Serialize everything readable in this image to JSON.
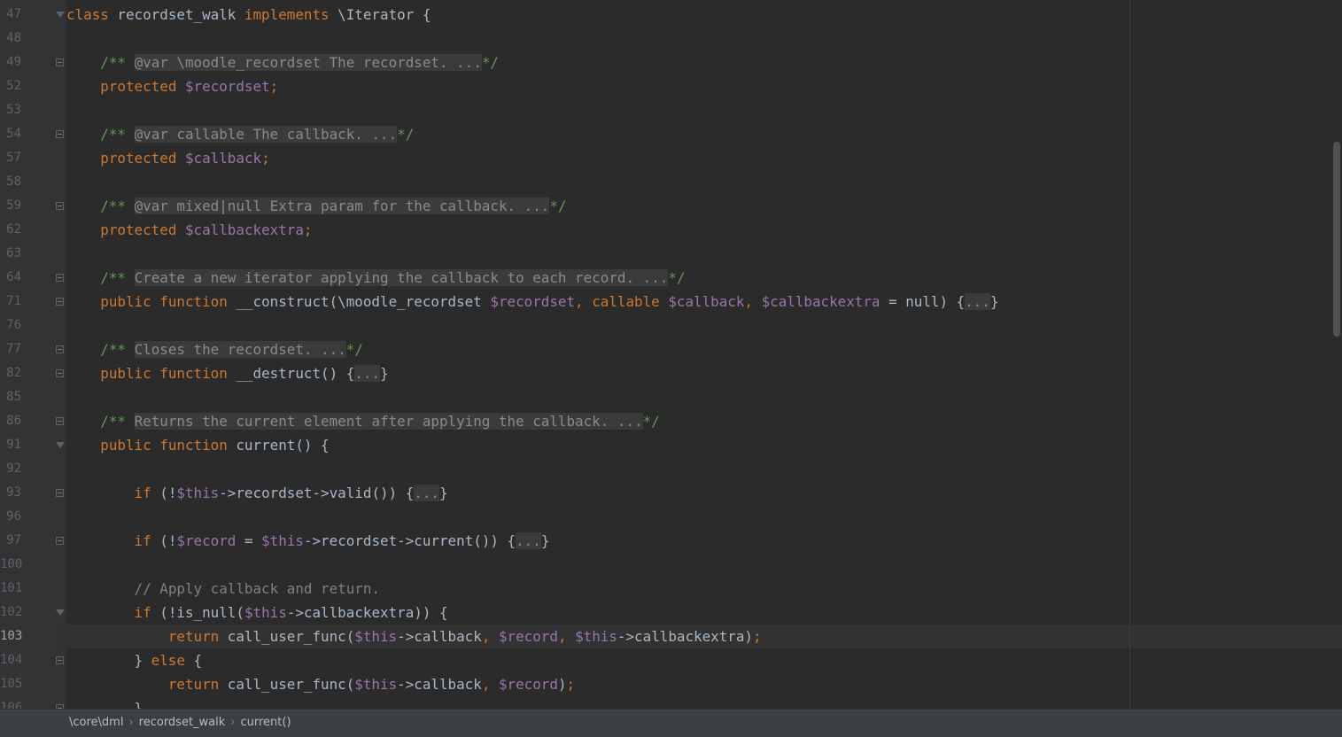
{
  "lines": [
    {
      "n": "47",
      "fold": "open",
      "t": [
        [
          "kw",
          "class"
        ],
        [
          "p",
          " recordset_walk "
        ],
        [
          "kw",
          "implements"
        ],
        [
          "p",
          " \\Iterator {"
        ]
      ]
    },
    {
      "n": "48",
      "t": []
    },
    {
      "n": "49",
      "fold": "box",
      "t": [
        [
          "p",
          "    "
        ],
        [
          "doc",
          "/** "
        ],
        [
          "foldtext",
          "@var \\moodle_recordset The recordset. ..."
        ],
        [
          "doc",
          "*/"
        ]
      ]
    },
    {
      "n": "52",
      "t": [
        [
          "p",
          "    "
        ],
        [
          "kw",
          "protected"
        ],
        [
          "p",
          " "
        ],
        [
          "var",
          "$recordset"
        ],
        [
          "kw",
          ";"
        ]
      ]
    },
    {
      "n": "53",
      "t": []
    },
    {
      "n": "54",
      "fold": "box",
      "t": [
        [
          "p",
          "    "
        ],
        [
          "doc",
          "/** "
        ],
        [
          "foldtext",
          "@var callable The callback. ..."
        ],
        [
          "doc",
          "*/"
        ]
      ]
    },
    {
      "n": "57",
      "t": [
        [
          "p",
          "    "
        ],
        [
          "kw",
          "protected"
        ],
        [
          "p",
          " "
        ],
        [
          "var",
          "$callback"
        ],
        [
          "kw",
          ";"
        ]
      ]
    },
    {
      "n": "58",
      "t": []
    },
    {
      "n": "59",
      "fold": "box",
      "t": [
        [
          "p",
          "    "
        ],
        [
          "doc",
          "/** "
        ],
        [
          "foldtext",
          "@var mixed|null Extra param for the callback. ..."
        ],
        [
          "doc",
          "*/"
        ]
      ]
    },
    {
      "n": "62",
      "t": [
        [
          "p",
          "    "
        ],
        [
          "kw",
          "protected"
        ],
        [
          "p",
          " "
        ],
        [
          "var",
          "$callbackextra"
        ],
        [
          "kw",
          ";"
        ]
      ]
    },
    {
      "n": "63",
      "t": []
    },
    {
      "n": "64",
      "fold": "box",
      "t": [
        [
          "p",
          "    "
        ],
        [
          "doc",
          "/** "
        ],
        [
          "foldtext",
          "Create a new iterator applying the callback to each record. ..."
        ],
        [
          "doc",
          "*/"
        ]
      ]
    },
    {
      "n": "71",
      "fold": "box",
      "t": [
        [
          "p",
          "    "
        ],
        [
          "kw",
          "public function"
        ],
        [
          "p",
          " __construct(\\moodle_recordset "
        ],
        [
          "var",
          "$recordset"
        ],
        [
          "kw",
          ", "
        ],
        [
          "kw",
          "callable"
        ],
        [
          "p",
          " "
        ],
        [
          "var",
          "$callback"
        ],
        [
          "kw",
          ", "
        ],
        [
          "var",
          "$callbackextra"
        ],
        [
          "p",
          " = null) {"
        ],
        [
          "foldbox",
          "..."
        ],
        [
          "p",
          "}"
        ]
      ]
    },
    {
      "n": "76",
      "t": []
    },
    {
      "n": "77",
      "fold": "box",
      "t": [
        [
          "p",
          "    "
        ],
        [
          "doc",
          "/** "
        ],
        [
          "foldtext",
          "Closes the recordset. ..."
        ],
        [
          "doc",
          "*/"
        ]
      ]
    },
    {
      "n": "82",
      "fold": "box",
      "t": [
        [
          "p",
          "    "
        ],
        [
          "kw",
          "public function"
        ],
        [
          "p",
          " __destruct() {"
        ],
        [
          "foldbox",
          "..."
        ],
        [
          "p",
          "}"
        ]
      ]
    },
    {
      "n": "85",
      "t": []
    },
    {
      "n": "86",
      "fold": "box",
      "t": [
        [
          "p",
          "    "
        ],
        [
          "doc",
          "/** "
        ],
        [
          "foldtext",
          "Returns the current element after applying the callback. ..."
        ],
        [
          "doc",
          "*/"
        ]
      ]
    },
    {
      "n": "91",
      "fold": "open",
      "t": [
        [
          "p",
          "    "
        ],
        [
          "kw",
          "public function"
        ],
        [
          "p",
          " current() {"
        ]
      ]
    },
    {
      "n": "92",
      "t": []
    },
    {
      "n": "93",
      "fold": "box",
      "t": [
        [
          "p",
          "        "
        ],
        [
          "kw",
          "if"
        ],
        [
          "p",
          " (!"
        ],
        [
          "var",
          "$this"
        ],
        [
          "p",
          "->recordset->valid()) {"
        ],
        [
          "foldbox",
          "..."
        ],
        [
          "p",
          "}"
        ]
      ]
    },
    {
      "n": "96",
      "t": []
    },
    {
      "n": "97",
      "fold": "box",
      "t": [
        [
          "p",
          "        "
        ],
        [
          "kw",
          "if"
        ],
        [
          "p",
          " (!"
        ],
        [
          "var",
          "$record"
        ],
        [
          "p",
          " = "
        ],
        [
          "var",
          "$this"
        ],
        [
          "p",
          "->recordset->current()) {"
        ],
        [
          "foldbox",
          "..."
        ],
        [
          "p",
          "}"
        ]
      ]
    },
    {
      "n": "100",
      "t": []
    },
    {
      "n": "101",
      "t": [
        [
          "p",
          "        "
        ],
        [
          "cm",
          "// Apply callback and return."
        ]
      ]
    },
    {
      "n": "102",
      "fold": "open",
      "t": [
        [
          "p",
          "        "
        ],
        [
          "kw",
          "if"
        ],
        [
          "p",
          " (!is_null("
        ],
        [
          "var",
          "$this"
        ],
        [
          "p",
          "->callbackextra)) {"
        ]
      ]
    },
    {
      "n": "103",
      "current": true,
      "t": [
        [
          "p",
          "            "
        ],
        [
          "kw",
          "return"
        ],
        [
          "p",
          " call_user_func("
        ],
        [
          "var",
          "$this"
        ],
        [
          "p",
          "->callback"
        ],
        [
          "kw",
          ", "
        ],
        [
          "var",
          "$record"
        ],
        [
          "kw",
          ", "
        ],
        [
          "var",
          "$this"
        ],
        [
          "p",
          "->callbackextra)"
        ],
        [
          "kw",
          ";"
        ]
      ]
    },
    {
      "n": "104",
      "fold": "box",
      "t": [
        [
          "p",
          "        } "
        ],
        [
          "kw",
          "else"
        ],
        [
          "p",
          " {"
        ]
      ]
    },
    {
      "n": "105",
      "t": [
        [
          "p",
          "            "
        ],
        [
          "kw",
          "return"
        ],
        [
          "p",
          " call_user_func("
        ],
        [
          "var",
          "$this"
        ],
        [
          "p",
          "->callback"
        ],
        [
          "kw",
          ", "
        ],
        [
          "var",
          "$record"
        ],
        [
          "p",
          ")"
        ],
        [
          "kw",
          ";"
        ]
      ]
    },
    {
      "n": "106",
      "fold": "box",
      "t": [
        [
          "p",
          "        }"
        ]
      ]
    }
  ],
  "breadcrumb": [
    "\\core\\dml",
    "recordset_walk",
    "current()"
  ],
  "colors": {
    "background": "#2b2b2b",
    "gutter": "#313335",
    "keyword": "#cc7832",
    "variable": "#9876aa",
    "comment": "#808080",
    "doc_comment": "#629755",
    "text": "#a9b7c6",
    "statusbar": "#3c3f41"
  }
}
